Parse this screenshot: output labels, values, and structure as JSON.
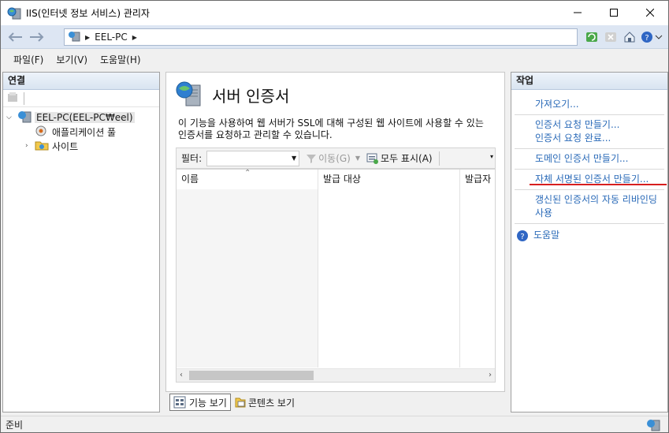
{
  "window": {
    "title": "IIS(인터넷 정보 서비스) 관리자"
  },
  "address": {
    "path": [
      "EEL-PC"
    ]
  },
  "menu": [
    "파일(F)",
    "보기(V)",
    "도움말(H)"
  ],
  "connections": {
    "header": "연결",
    "tree": [
      {
        "label": "EEL-PC(EEL-PC₩eel)",
        "expanded": true,
        "selected": true
      },
      {
        "label": "애플리케이션 풀"
      },
      {
        "label": "사이트",
        "expandable": true
      }
    ]
  },
  "main": {
    "title": "서버 인증서",
    "description": "이 기능을 사용하여 웹 서버가 SSL에 대해 구성된 웹 사이트에 사용할 수 있는 인증서를 요청하고 관리할 수 있습니다.",
    "filter_label": "필터:",
    "go_label": "이동(G)",
    "show_all_label": "모두 표시(A)",
    "columns": [
      "이름",
      "발급 대상",
      "발급자"
    ]
  },
  "view_tabs": [
    "기능 보기",
    "콘텐츠 보기"
  ],
  "actions": {
    "header": "작업",
    "groups": [
      [
        "가져오기..."
      ],
      [
        "인증서 요청 만들기...",
        "인증서 요청 완료..."
      ],
      [
        "도메인 인증서 만들기..."
      ],
      [
        "자체 서명된 인증서 만들기..."
      ],
      [
        "갱신된 인증서의 자동 리바인딩 사용"
      ]
    ],
    "help_label": "도움말"
  },
  "status": {
    "text": "준비"
  },
  "colors": {
    "link": "#2a6ab8",
    "highlight_underline": "#d71e1e",
    "address_bar": "#dde6f3"
  }
}
